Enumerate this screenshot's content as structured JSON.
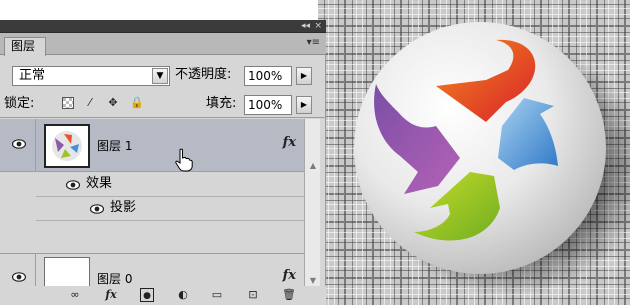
{
  "panel": {
    "tab_label": "图层",
    "collapse_glyph": "◂◂",
    "close_glyph": "×",
    "menu_glyph": "▾≡"
  },
  "blend": {
    "mode": "正常",
    "opacity_label": "不透明度:",
    "opacity_value": "100%",
    "lock_label": "锁定:",
    "fill_label": "填充:",
    "fill_value": "100%"
  },
  "layers": [
    {
      "name": "图层 1",
      "fx": "fx",
      "selected": true
    },
    {
      "name": "图层 0",
      "fx": "fx",
      "selected": false
    }
  ],
  "effects": {
    "group_label": "效果",
    "drop_shadow_label": "投影"
  },
  "icons": {
    "lock_transparent": "checker-lock-icon",
    "lock_paint": "brush-lock-icon",
    "lock_move": "move-lock-icon",
    "lock_all": "padlock-icon",
    "eye": "eye-icon",
    "link": "link-icon",
    "fx": "fx-icon",
    "mask": "mask-icon",
    "adjustment": "adjustment-icon",
    "folder": "folder-icon",
    "new_layer": "new-layer-icon",
    "trash": "trash-icon"
  },
  "colors": {
    "selected_row": "#b5bac4",
    "arrow_orange": "#e8542a",
    "arrow_purple": "#8b5aa8",
    "arrow_blue": "#4a90d4",
    "arrow_green": "#9cc42a"
  }
}
